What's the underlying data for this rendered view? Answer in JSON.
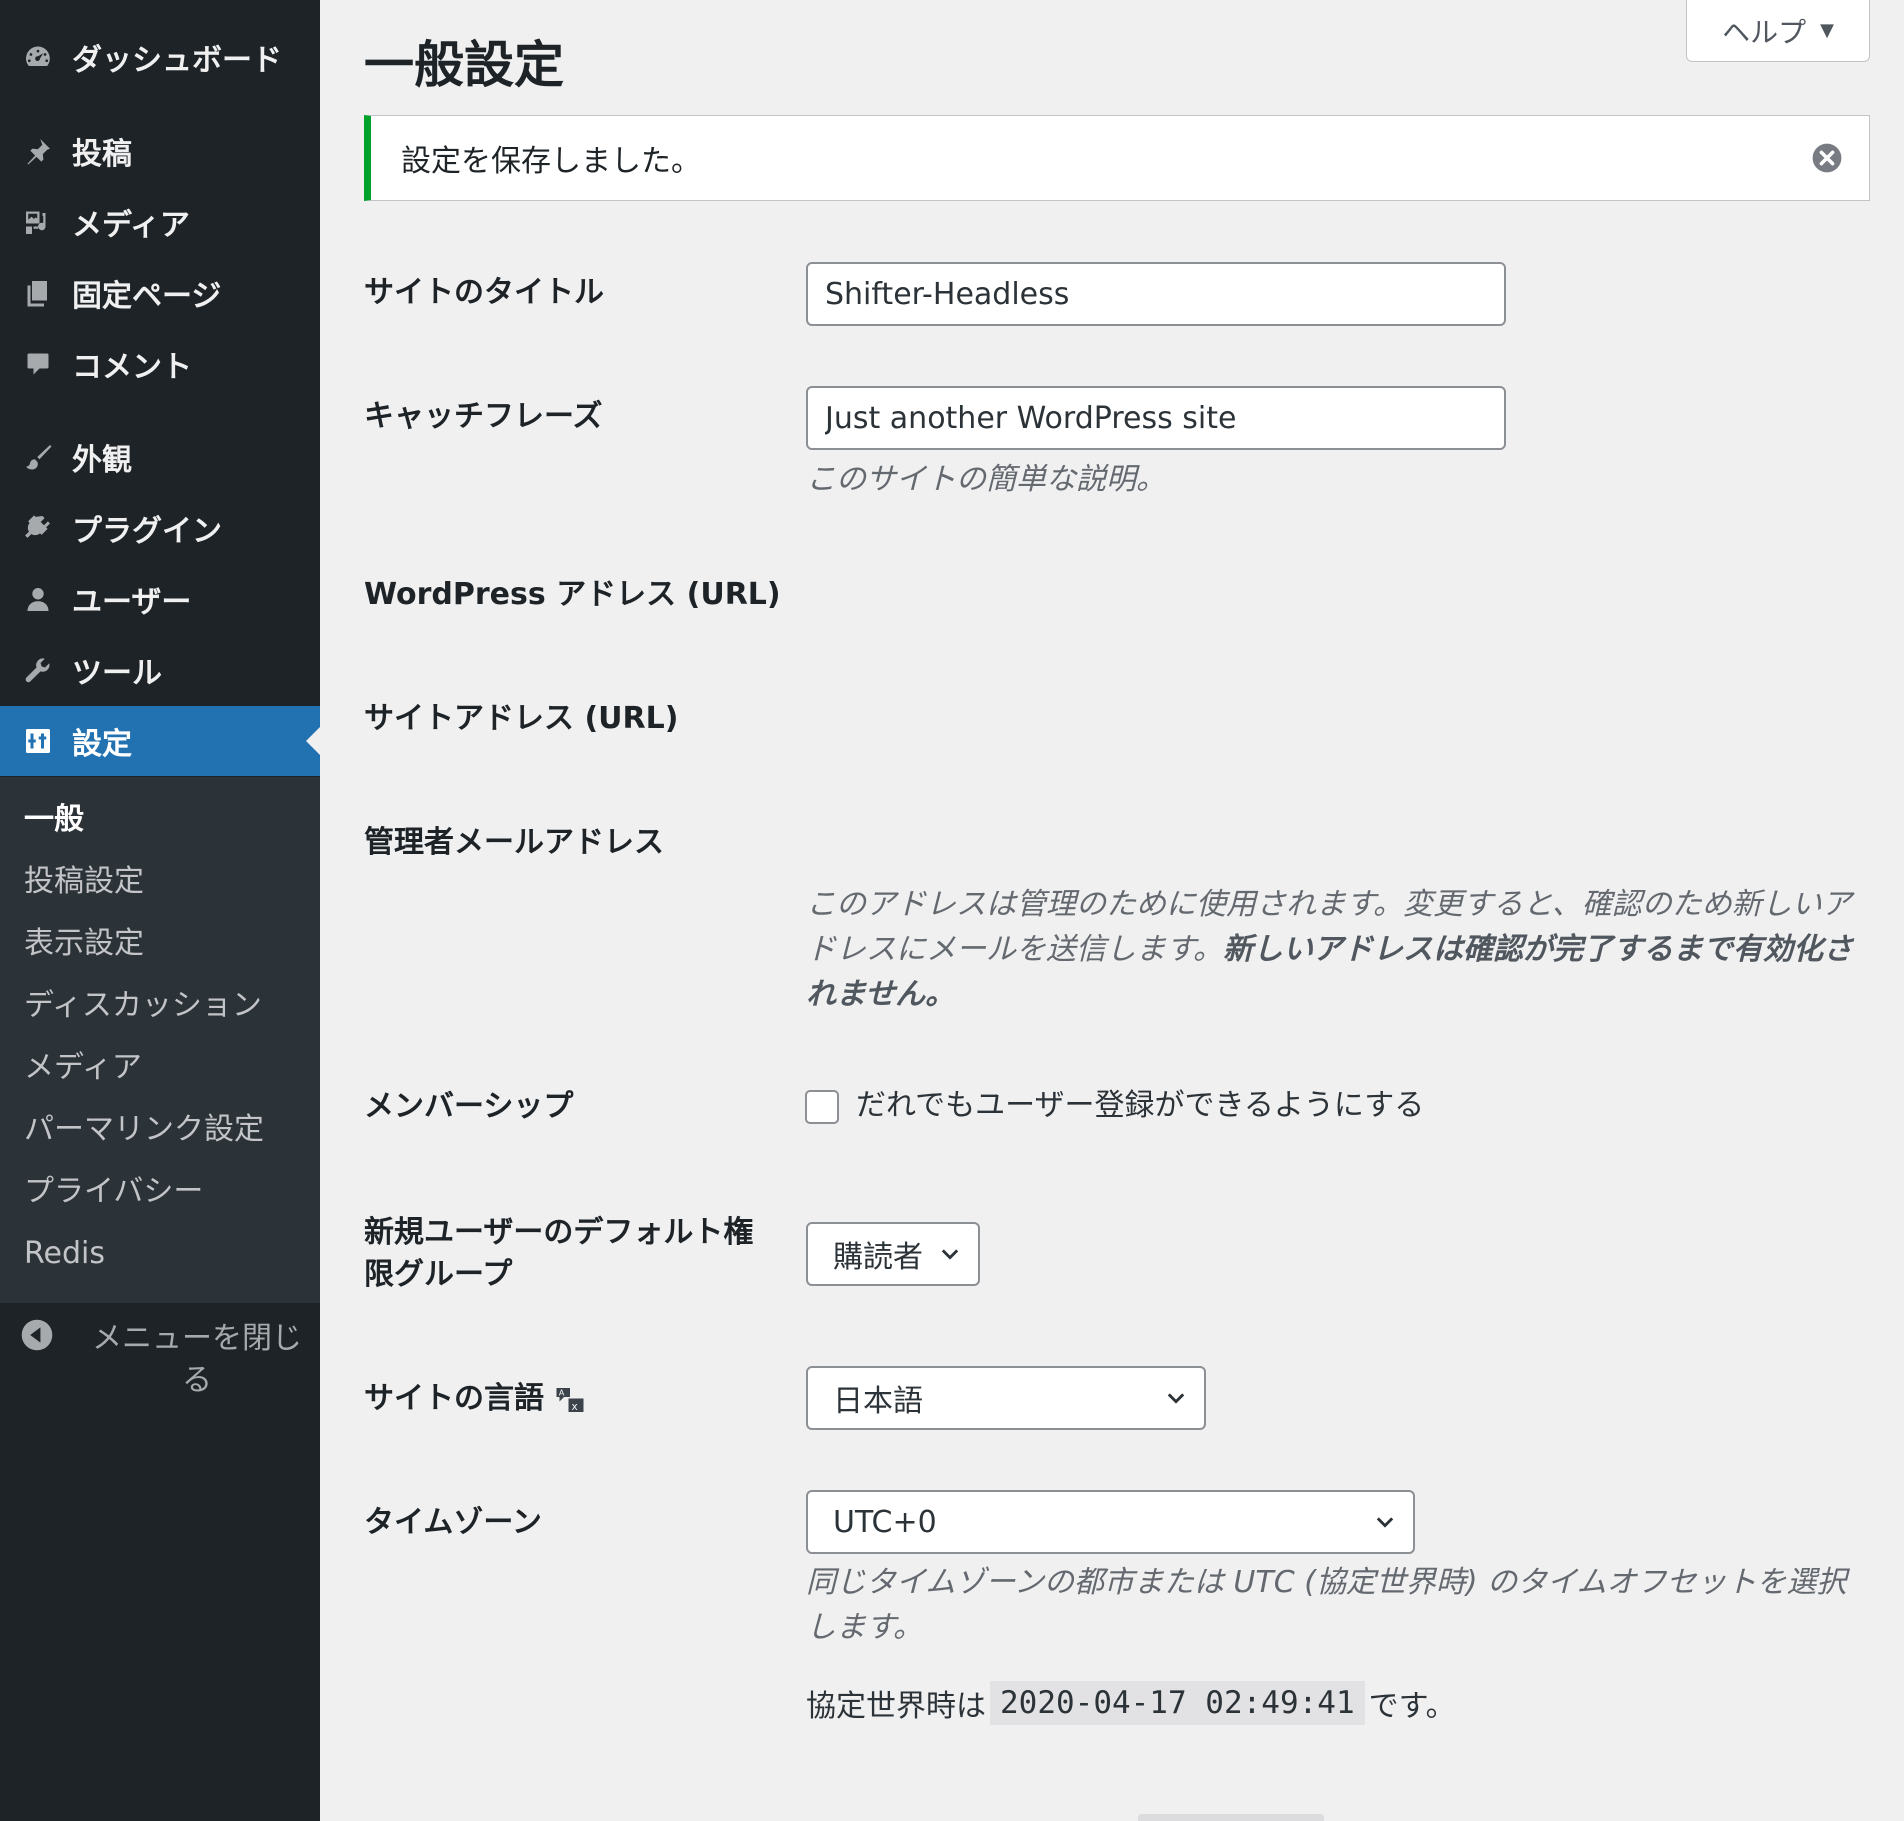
{
  "sidebar": {
    "menu": [
      {
        "label": "ダッシュボード",
        "icon": "dashboard-icon"
      },
      {
        "label": "投稿",
        "icon": "pin-icon"
      },
      {
        "label": "メディア",
        "icon": "media-icon"
      },
      {
        "label": "固定ページ",
        "icon": "page-icon"
      },
      {
        "label": "コメント",
        "icon": "comment-icon"
      },
      {
        "label": "外観",
        "icon": "brush-icon"
      },
      {
        "label": "プラグイン",
        "icon": "plugin-icon"
      },
      {
        "label": "ユーザー",
        "icon": "user-icon"
      },
      {
        "label": "ツール",
        "icon": "wrench-icon"
      },
      {
        "label": "設定",
        "icon": "settings-icon"
      }
    ],
    "submenu": [
      "一般",
      "投稿設定",
      "表示設定",
      "ディスカッション",
      "メディア",
      "パーマリンク設定",
      "プライバシー",
      "Redis"
    ],
    "collapse_line1": "メニューを閉じ",
    "collapse_line2": "る"
  },
  "header": {
    "help_label": "ヘルプ",
    "page_title": "一般設定"
  },
  "notice": {
    "message": "設定を保存しました。"
  },
  "form": {
    "site_title_label": "サイトのタイトル",
    "site_title_value": "Shifter-Headless",
    "tagline_label": "キャッチフレーズ",
    "tagline_value": "Just another WordPress site",
    "tagline_description": "このサイトの簡単な説明。",
    "wp_address_label": "WordPress アドレス (URL)",
    "site_address_label": "サイトアドレス (URL)",
    "admin_email_label": "管理者メールアドレス",
    "admin_email_desc_line1": "このアドレスは管理のために使用されます。変更すると、確認のため新しいア",
    "admin_email_desc_line2_normal": "ドレスにメールを送信します。",
    "admin_email_desc_line2_bold": "新しいアドレスは確認が完了するまで有効化さ",
    "admin_email_desc_line3_bold": "れません。",
    "membership_label": "メンバーシップ",
    "membership_checkbox_label": "だれでもユーザー登録ができるようにする",
    "default_role_label_line1": "新規ユーザーのデフォルト権",
    "default_role_label_line2": "限グループ",
    "default_role_value": "購読者",
    "site_language_label": "サイトの言語",
    "site_language_value": "日本語",
    "timezone_label": "タイムゾーン",
    "timezone_value": "UTC+0",
    "timezone_desc_line1": "同じタイムゾーンの都市または UTC (協定世界時) のタイムオフセットを選択",
    "timezone_desc_line2": "します。",
    "utc_prefix": "協定世界時は",
    "utc_time": "2020-04-17 02:49:41",
    "utc_suffix": "です。"
  },
  "colors": {
    "sidebar_bg": "#1d2327",
    "submenu_bg": "#2c3338",
    "accent": "#2271b1",
    "notice_success": "#00a32a",
    "page_bg": "#f0f0f1"
  }
}
